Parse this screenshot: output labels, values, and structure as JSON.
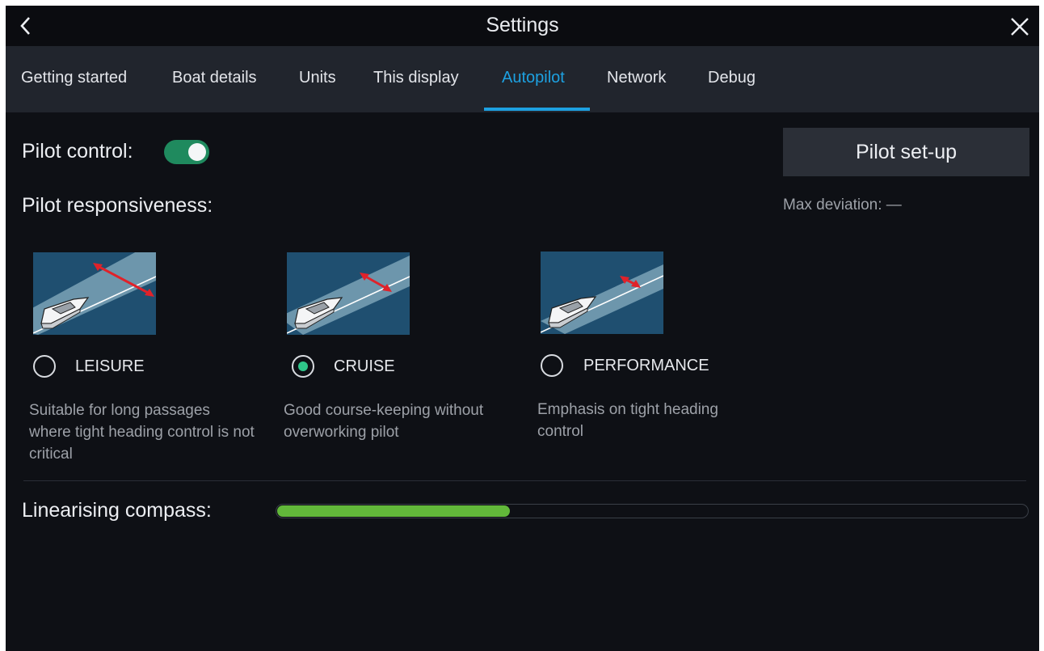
{
  "header": {
    "title": "Settings",
    "back_icon": "chevron-left-icon",
    "close_icon": "close-icon"
  },
  "tabs": [
    {
      "label": "Getting started",
      "active": false
    },
    {
      "label": "Boat details",
      "active": false
    },
    {
      "label": "Units",
      "active": false
    },
    {
      "label": "This display",
      "active": false
    },
    {
      "label": "Autopilot",
      "active": true
    },
    {
      "label": "Network",
      "active": false
    },
    {
      "label": "Debug",
      "active": false
    }
  ],
  "pilot_control": {
    "label": "Pilot control:",
    "enabled": true
  },
  "pilot_setup": {
    "button_label": "Pilot set-up",
    "max_deviation": "Max deviation: —"
  },
  "responsiveness": {
    "label": "Pilot responsiveness:",
    "options": [
      {
        "label": "LEISURE",
        "selected": false,
        "description": "Suitable for long passages where tight heading control is not critical"
      },
      {
        "label": "CRUISE",
        "selected": true,
        "description": "Good course-keeping without overworking pilot"
      },
      {
        "label": "PERFORMANCE",
        "selected": false,
        "description": "Emphasis on tight heading control"
      }
    ]
  },
  "compass": {
    "label": "Linearising compass:",
    "progress": 0.31
  },
  "colors": {
    "accent": "#1da1e1",
    "toggle_on": "#1f8a5e",
    "radio_selected": "#2fc58a",
    "progress": "#62b83a",
    "deviation_arrow": "#e0222a"
  }
}
